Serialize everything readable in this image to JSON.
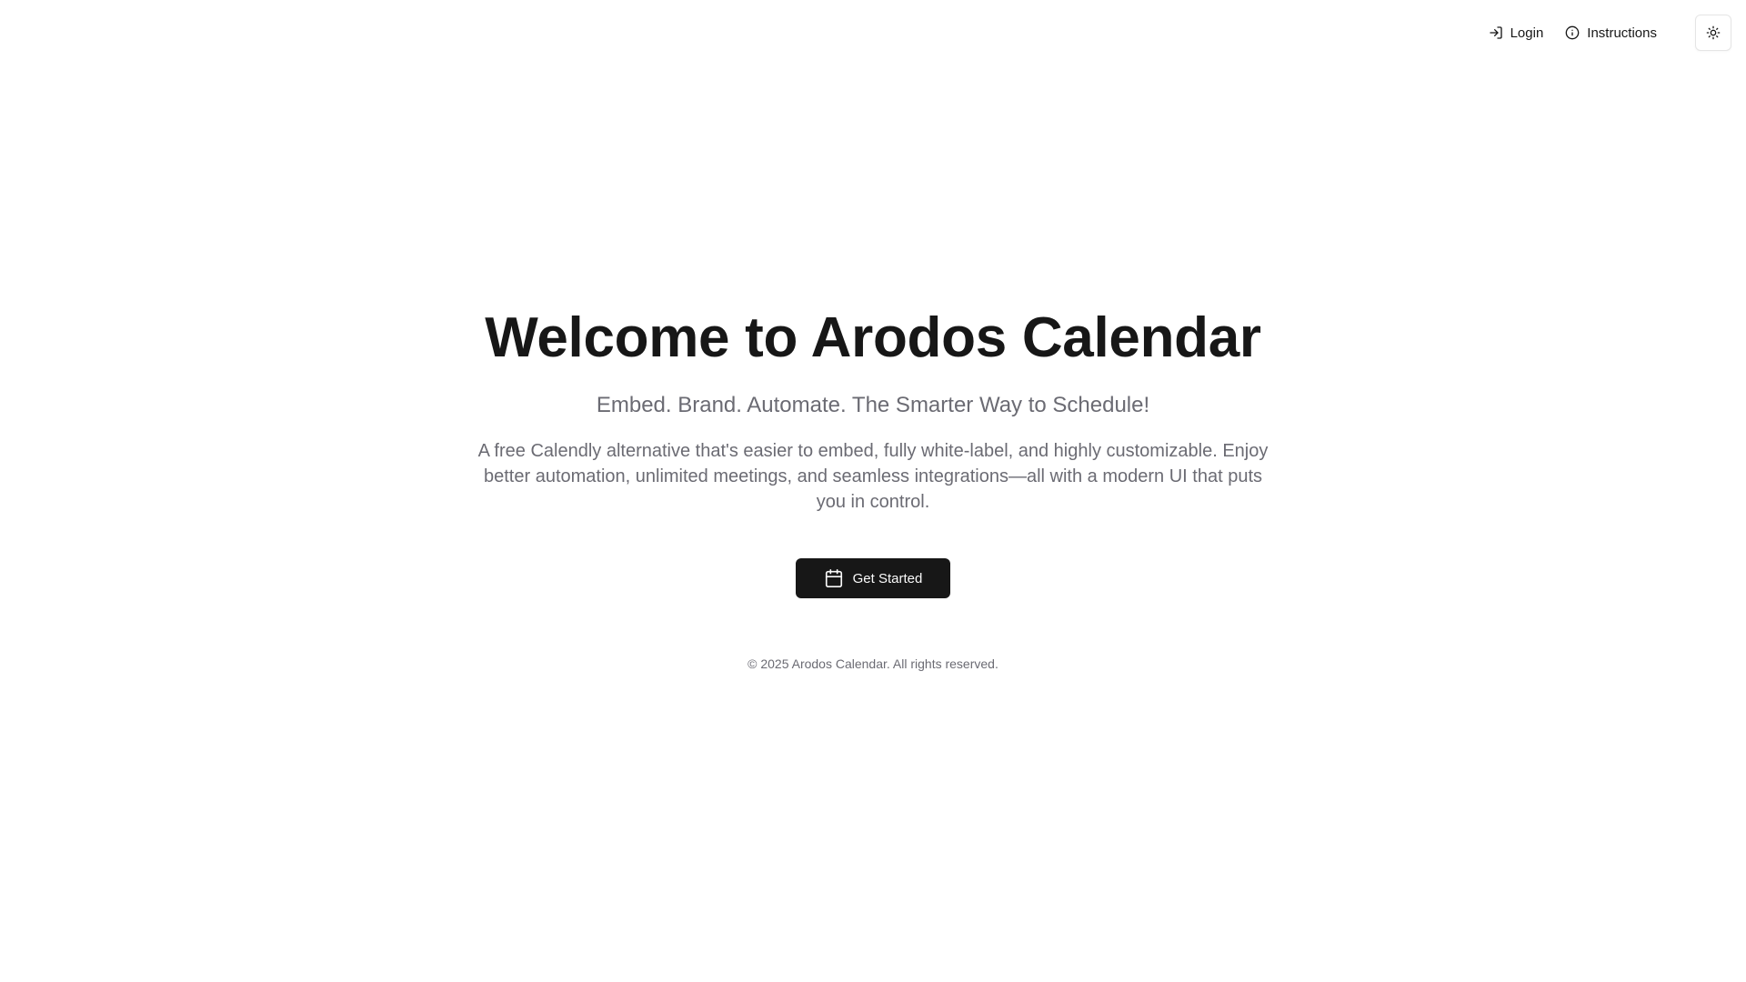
{
  "nav": {
    "login_label": "Login",
    "login_icon": "log-in-icon",
    "instructions_label": "Instructions",
    "instructions_icon": "info-icon",
    "theme_toggle_icon": "sun-icon"
  },
  "hero": {
    "title": "Welcome to Arodos Calendar",
    "tagline": "Embed. Brand. Automate. The Smarter Way to Schedule!",
    "description": "A free Calendly alternative that's easier to embed, fully white-label, and highly customizable. Enjoy better automation, unlimited meetings, and seamless integrations—all with a modern UI that puts you in control.",
    "cta_label": "Get Started",
    "cta_icon": "calendar-icon"
  },
  "footer": {
    "copyright": "© 2025 Arodos Calendar. All rights reserved."
  },
  "colors": {
    "primary": "#171717",
    "muted_text": "#6b6b73",
    "background": "#ffffff",
    "border": "#e5e5e5"
  }
}
